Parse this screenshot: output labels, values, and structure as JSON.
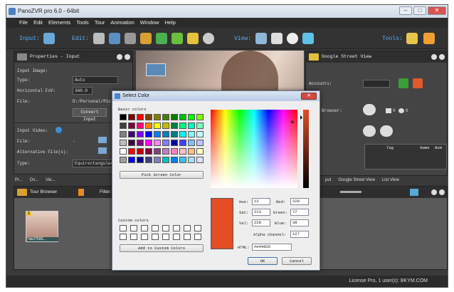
{
  "window": {
    "title": "PanoZVR pro 6.0 - 64bit"
  },
  "menu": [
    "File",
    "Edit",
    "Elements",
    "Tools",
    "Tour",
    "Animation",
    "Window",
    "Help"
  ],
  "toolbar": {
    "input_label": "Input:",
    "edit_label": "Edit:",
    "view_label": "View:",
    "tools_label": "Tools:"
  },
  "properties": {
    "title": "Properties - Input",
    "input_image": "Input Image:",
    "type_label": "Type:",
    "type_value": "Auto",
    "hfov_label": "Horizontal FoV:",
    "hfov_value": "360.0",
    "file_label": "File:",
    "file_value": "D:/Personal/Pictu...",
    "convert_button": "Convert Input",
    "input_video": "Input Video:",
    "vfile_label": "File:",
    "vfile_value": "-",
    "alt_label": "Alternative File(s):",
    "vtype_label": "Type:",
    "vtype_value": "Equirectangular"
  },
  "left_tabs": [
    "Pr...",
    "Ov...",
    "Vie..."
  ],
  "tour_browser": {
    "title": "Tour Browser",
    "filter_label": "Filter:",
    "thumb_badge": "1",
    "thumb_caption": "7de2759E..."
  },
  "street_view": {
    "title": "Google Street View",
    "accounts_label": "Accounts:",
    "browser_label": "View Browser:",
    "counter_a": "0",
    "counter_b": "0",
    "col_tag": "Tag",
    "col_name": "Name",
    "col_num": "Num"
  },
  "right_tabs": [
    "put",
    "Google Street View",
    "List View"
  ],
  "dialog": {
    "title": "Select Color",
    "basic_colors": "Basic colors",
    "pick_button": "Pick Screen Color",
    "custom_colors": "Custom colors",
    "add_button": "Add to Custom Colors",
    "hue_label": "Hue:",
    "hue_value": "12",
    "sat_label": "Sat:",
    "sat_value": "213",
    "val_label": "Val:",
    "val_value": "228",
    "red_label": "Red:",
    "red_value": "228",
    "green_label": "Green:",
    "green_value": "77",
    "blue_label": "Blue:",
    "blue_value": "38",
    "alpha_label": "Alpha channel:",
    "alpha_value": "127",
    "html_label": "HTML:",
    "html_value": "#e44d26",
    "ok_button": "OK",
    "cancel_button": "Cancel",
    "current_color": "#e44d26"
  },
  "basic_palette": [
    "#000000",
    "#800000",
    "#ff0000",
    "#804000",
    "#808000",
    "#408000",
    "#008000",
    "#00c000",
    "#00ff00",
    "#80ff00",
    "#404040",
    "#800040",
    "#ff0080",
    "#ff8000",
    "#ffff00",
    "#c0c000",
    "#008040",
    "#00ff80",
    "#00ffc0",
    "#80ffc0",
    "#808080",
    "#400080",
    "#8000ff",
    "#0000ff",
    "#0080ff",
    "#0080c0",
    "#008080",
    "#00ffff",
    "#80ffff",
    "#c0ffff",
    "#c0c0c0",
    "#400040",
    "#800080",
    "#ff00ff",
    "#ff80ff",
    "#8080ff",
    "#0000a0",
    "#4040ff",
    "#80c0ff",
    "#c0c0ff",
    "#ffffff",
    "#ff0000",
    "#c00000",
    "#800040",
    "#804080",
    "#c080c0",
    "#ff80c0",
    "#ffc0c0",
    "#ffc080",
    "#ffffc0",
    "#a0a0a0",
    "#0000ff",
    "#000080",
    "#404080",
    "#8080c0",
    "#00c0c0",
    "#0080ff",
    "#40c0ff",
    "#a0e0ff",
    "#e0e0ff"
  ],
  "status": {
    "text": "License Pro, 1 user(s): BKYM.COM"
  }
}
